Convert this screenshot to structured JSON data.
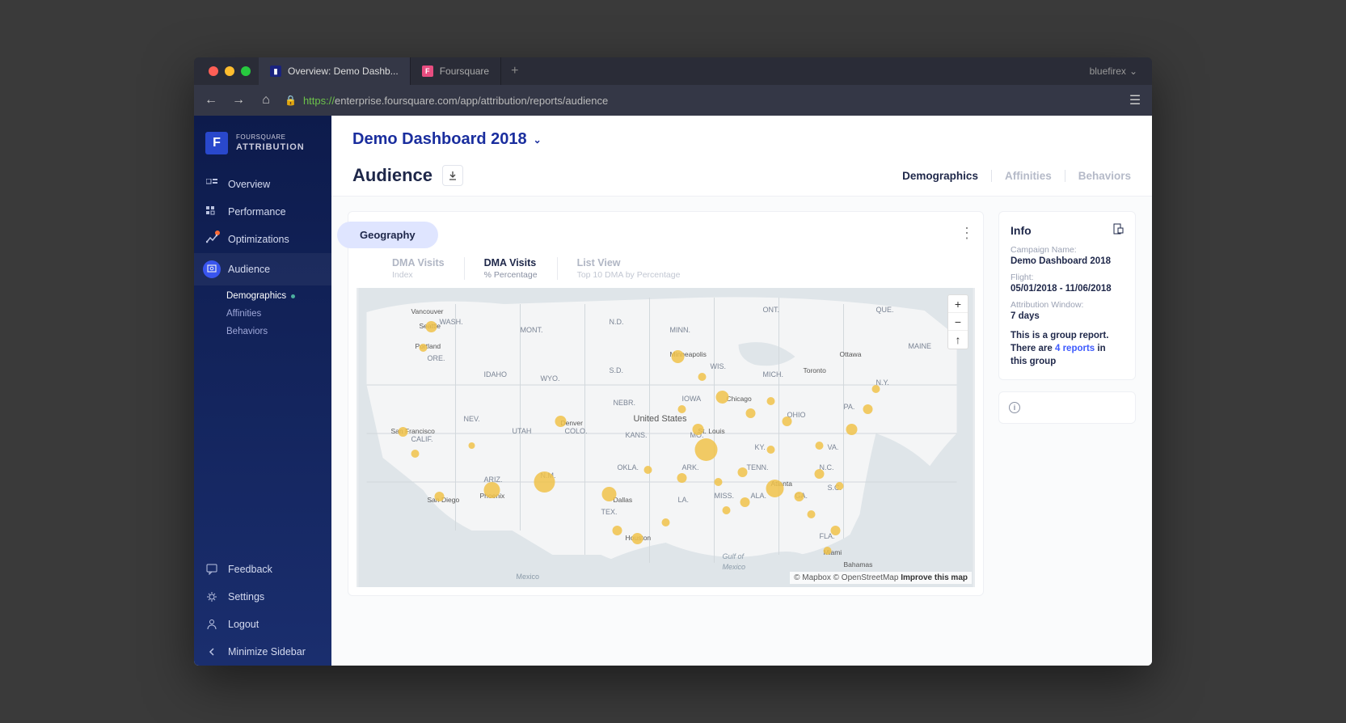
{
  "browser": {
    "tabs": [
      {
        "label": "Overview: Demo Dashb...",
        "favicon": "chart"
      },
      {
        "label": "Foursquare",
        "favicon": "fsq"
      }
    ],
    "user": "bluefirex",
    "url_https": "https://",
    "url_rest": "enterprise.foursquare.com/app/attribution/reports/audience"
  },
  "brand": {
    "top": "FOURSQUARE",
    "bottom": "ATTRIBUTION"
  },
  "sidebar": {
    "items": [
      {
        "label": "Overview"
      },
      {
        "label": "Performance"
      },
      {
        "label": "Optimizations"
      },
      {
        "label": "Audience"
      }
    ],
    "sub": [
      {
        "label": "Demographics"
      },
      {
        "label": "Affinities"
      },
      {
        "label": "Behaviors"
      }
    ],
    "footer": [
      {
        "label": "Feedback"
      },
      {
        "label": "Settings"
      },
      {
        "label": "Logout"
      },
      {
        "label": "Minimize Sidebar"
      }
    ]
  },
  "header": {
    "dashboard": "Demo Dashboard 2018",
    "page_title": "Audience",
    "tabs": [
      {
        "label": "Demographics"
      },
      {
        "label": "Affinities"
      },
      {
        "label": "Behaviors"
      }
    ]
  },
  "map": {
    "section": "Geography",
    "tabs": [
      {
        "title": "DMA Visits",
        "sub": "Index"
      },
      {
        "title": "DMA Visits",
        "sub": "% Percentage"
      },
      {
        "title": "List View",
        "sub": "Top 10 DMA by Percentage"
      }
    ],
    "attribution": {
      "mapbox": "© Mapbox",
      "osm": "© OpenStreetMap",
      "improve": "Improve this map"
    },
    "labels": {
      "country": "United States",
      "gulf": "Gulf of",
      "gulf2": "Mexico",
      "mexico": "Mexico",
      "cities": [
        "Vancouver",
        "Seattle",
        "Portland",
        "San Francisco",
        "San Diego",
        "Phoenix",
        "Denver",
        "Minneapolis",
        "Chicago",
        "Toronto",
        "Ottawa",
        "Houston",
        "Dallas",
        "Atlanta",
        "Miami",
        "St. Louis",
        "Bahamas"
      ],
      "states": [
        "WASH.",
        "MONT.",
        "N.D.",
        "MINN.",
        "S.D.",
        "WIS.",
        "MICH.",
        "ORE.",
        "IDAHO",
        "WYO.",
        "NEBR.",
        "IOWA",
        "OHIO",
        "PA.",
        "CALIF.",
        "NEV.",
        "UTAH",
        "COLO.",
        "KANS.",
        "MO.",
        "KY.",
        "VA.",
        "ARIZ.",
        "N.M.",
        "OKLA.",
        "ARK.",
        "TENN.",
        "N.C.",
        "TEX.",
        "LA.",
        "MISS.",
        "ALA.",
        "GA.",
        "S.C.",
        "FLA.",
        "ONT.",
        "QUE.",
        "MAINE",
        "N.Y."
      ]
    }
  },
  "info": {
    "title": "Info",
    "campaign_label": "Campaign Name:",
    "campaign_val": "Demo Dashboard 2018",
    "flight_label": "Flight:",
    "flight_val": "05/01/2018 - 11/06/2018",
    "attr_label": "Attribution Window:",
    "attr_val": "7 days",
    "group1": "This is a group report.",
    "group2a": "There are ",
    "group2b": "4 reports",
    "group2c": " in this group"
  }
}
